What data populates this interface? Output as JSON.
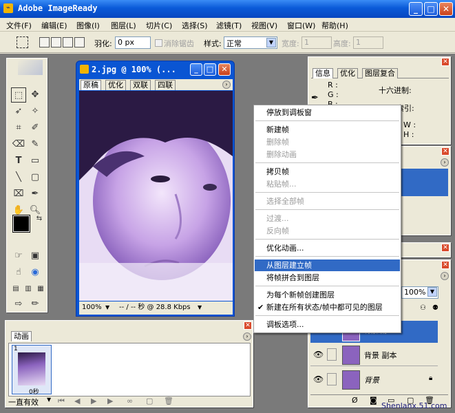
{
  "app": {
    "title": "Adobe ImageReady",
    "min": "_",
    "max": "□",
    "close": "✕"
  },
  "menu": [
    "文件(F)",
    "编辑(E)",
    "图像(I)",
    "图层(L)",
    "切片(C)",
    "选择(S)",
    "滤镜(T)",
    "视图(V)",
    "窗口(W)",
    "帮助(H)"
  ],
  "options": {
    "feather_label": "羽化:",
    "feather_value": "0 px",
    "antialias_label": "消除锯齿",
    "style_label": "样式:",
    "style_value": "正常",
    "width_label": "宽度:",
    "width_value": "1",
    "height_label": "高度:",
    "height_value": "1"
  },
  "document": {
    "title": "2.jpg @ 100% (...",
    "tabs": [
      "原稿",
      "优化",
      "双联",
      "四联"
    ],
    "zoom": "100%",
    "status": "-- / -- 秒 @ 28.8 Kbps"
  },
  "info_panel": {
    "tabs": [
      "信息",
      "优化",
      "图层复合"
    ],
    "r": "R :",
    "g": "G :",
    "b": "B :",
    "hex_label": "十六进制:",
    "index_label": "索引:",
    "w": "W :",
    "h": "H :"
  },
  "animation_panel": {
    "tab": "动画",
    "frame_number": "1",
    "frame_delay": "0秒",
    "loop": "一直有效"
  },
  "layers_panel": {
    "opacity": "100%",
    "layers": [
      {
        "name": "背景 副本"
      },
      {
        "name": "背景"
      }
    ],
    "top_layer_partial": "背景 副..."
  },
  "context_menu": {
    "items": [
      {
        "label": "停放到调板窗",
        "disabled": false
      },
      {
        "label": "新建帧",
        "disabled": false
      },
      {
        "label": "删除帧",
        "disabled": true
      },
      {
        "label": "删除动画",
        "disabled": true
      },
      {
        "label": "拷贝帧",
        "disabled": false
      },
      {
        "label": "粘贴帧...",
        "disabled": true
      },
      {
        "label": "选择全部帧",
        "disabled": true
      },
      {
        "label": "过渡...",
        "disabled": true
      },
      {
        "label": "反向帧",
        "disabled": true
      },
      {
        "label": "优化动画...",
        "disabled": false
      },
      {
        "label": "从图层建立帧",
        "disabled": false,
        "highlighted": true
      },
      {
        "label": "将帧拼合到图层",
        "disabled": false
      },
      {
        "label": "为每个新帧创建图层",
        "disabled": false
      },
      {
        "label": "新建在所有状态/帧中都可见的图层",
        "disabled": false,
        "checked": true
      },
      {
        "label": "调板选项...",
        "disabled": false
      }
    ]
  },
  "watermark": "Shenlanx.51.com",
  "colors": {
    "titlebar": "#0a5ad8",
    "highlight": "#316ac5",
    "desktop": "#7a7a7a",
    "panel": "#ece9d8"
  }
}
